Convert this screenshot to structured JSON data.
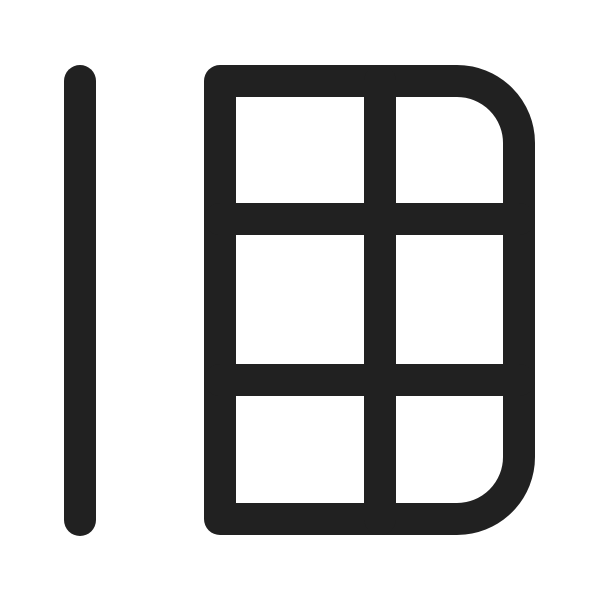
{
  "icon": {
    "name": "table-freeze-column-icon",
    "stroke_color": "#212121",
    "background_color": "#ffffff"
  }
}
